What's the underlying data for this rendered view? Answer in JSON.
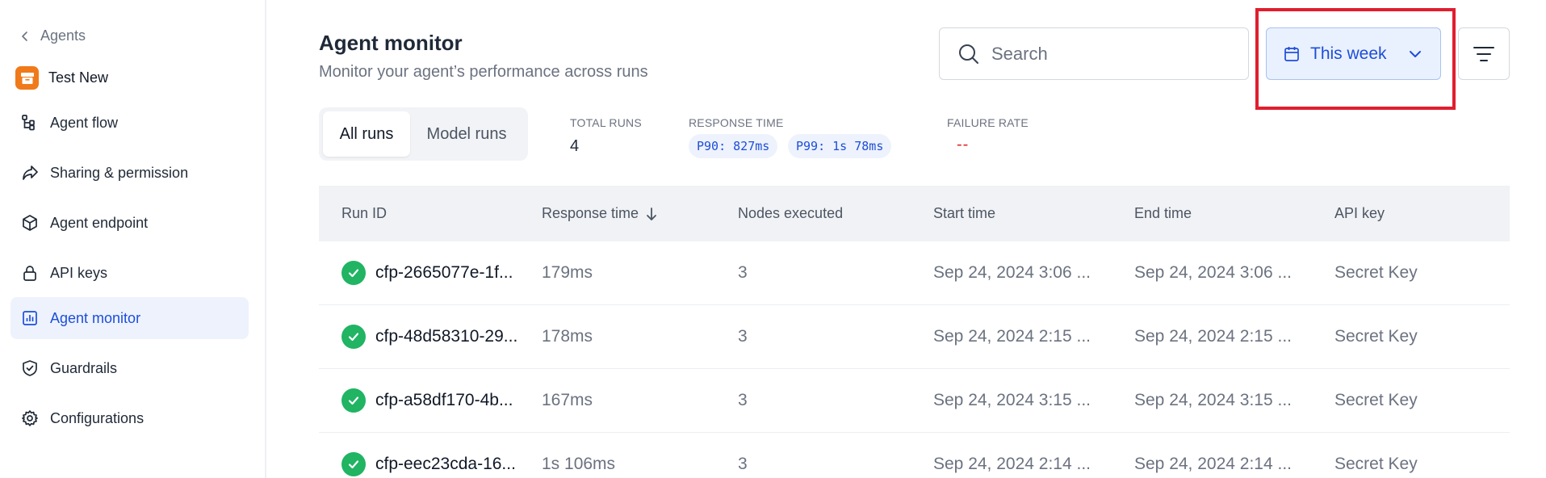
{
  "sidebar": {
    "back_label": "Agents",
    "agent_name": "Test New",
    "items": [
      {
        "label": "Agent flow",
        "icon": "flow-icon"
      },
      {
        "label": "Sharing & permission",
        "icon": "share-icon"
      },
      {
        "label": "Agent endpoint",
        "icon": "cube-icon"
      },
      {
        "label": "API keys",
        "icon": "lock-icon"
      },
      {
        "label": "Agent monitor",
        "icon": "chart-icon",
        "active": true
      },
      {
        "label": "Guardrails",
        "icon": "shield-icon"
      },
      {
        "label": "Configurations",
        "icon": "gear-icon"
      }
    ]
  },
  "header": {
    "title": "Agent monitor",
    "subtitle": "Monitor your agent’s performance across runs",
    "search_placeholder": "Search",
    "date_filter": "This week"
  },
  "tabs": [
    {
      "label": "All runs",
      "active": true
    },
    {
      "label": "Model runs",
      "active": false
    }
  ],
  "stats": {
    "total_runs_label": "TOTAL RUNS",
    "total_runs_value": "4",
    "response_time_label": "RESPONSE TIME",
    "p90": "P90: 827ms",
    "p99": "P99: 1s 78ms",
    "failure_rate_label": "FAILURE RATE",
    "failure_rate_value": "--"
  },
  "table": {
    "columns": [
      "Run ID",
      "Response time",
      "Nodes executed",
      "Start time",
      "End time",
      "API key"
    ],
    "rows": [
      {
        "run_id": "cfp-2665077e-1f...",
        "response": "179ms",
        "nodes": "3",
        "start": "Sep 24, 2024 3:06 ...",
        "end": "Sep 24, 2024 3:06 ...",
        "api_key": "Secret Key"
      },
      {
        "run_id": "cfp-48d58310-29...",
        "response": "178ms",
        "nodes": "3",
        "start": "Sep 24, 2024 2:15 ...",
        "end": "Sep 24, 2024 2:15 ...",
        "api_key": "Secret Key"
      },
      {
        "run_id": "cfp-a58df170-4b...",
        "response": "167ms",
        "nodes": "3",
        "start": "Sep 24, 2024 3:15 ...",
        "end": "Sep 24, 2024 3:15 ...",
        "api_key": "Secret Key"
      },
      {
        "run_id": "cfp-eec23cda-16...",
        "response": "1s 106ms",
        "nodes": "3",
        "start": "Sep 24, 2024 2:14 ...",
        "end": "Sep 24, 2024 2:14 ...",
        "api_key": "Secret Key"
      }
    ]
  },
  "colors": {
    "accent": "#1d4ed8",
    "success": "#20b463",
    "highlight": "#e01e2e",
    "brand": "#f07a1a"
  }
}
